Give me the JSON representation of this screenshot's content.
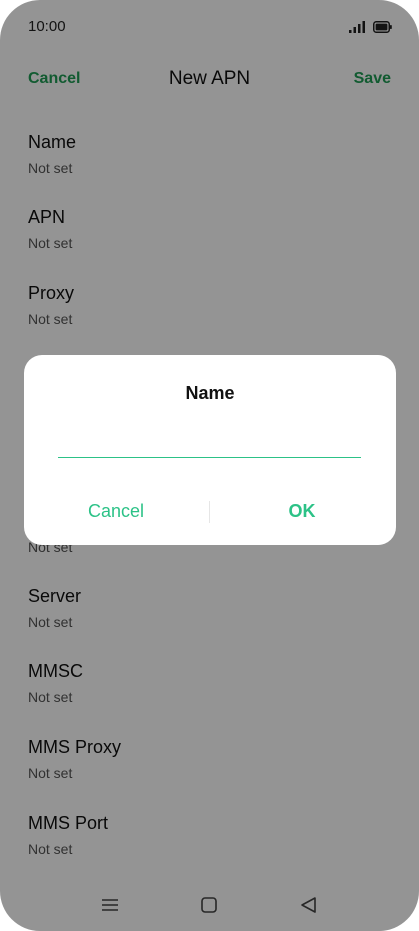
{
  "status_bar": {
    "time": "10:00"
  },
  "header": {
    "cancel_label": "Cancel",
    "title": "New APN",
    "save_label": "Save"
  },
  "apn_fields": [
    {
      "label": "Name",
      "value": "Not set"
    },
    {
      "label": "APN",
      "value": "Not set"
    },
    {
      "label": "Proxy",
      "value": "Not set"
    },
    {
      "label": "",
      "value": "Not set"
    },
    {
      "label": "Server",
      "value": "Not set"
    },
    {
      "label": "MMSC",
      "value": "Not set"
    },
    {
      "label": "MMS Proxy",
      "value": "Not set"
    },
    {
      "label": "MMS Port",
      "value": "Not set"
    }
  ],
  "dialog": {
    "title": "Name",
    "input_value": "",
    "cancel_label": "Cancel",
    "ok_label": "OK"
  },
  "colors": {
    "accent": "#2cc287",
    "header_accent": "#1f9d55",
    "scrim": "#000000"
  },
  "icons": {
    "nav": [
      "menu-icon",
      "home-square-icon",
      "back-triangle-icon"
    ],
    "status": [
      "cellular-signal-icon",
      "battery-icon"
    ]
  }
}
